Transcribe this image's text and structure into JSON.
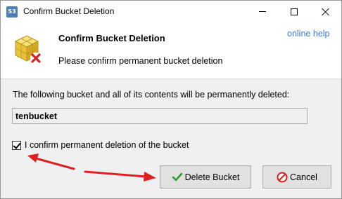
{
  "window": {
    "title": "Confirm Bucket Deletion",
    "app_icon_text": "S3"
  },
  "header": {
    "title": "Confirm Bucket Deletion",
    "subtitle": "Please confirm permanent bucket deletion",
    "help_link": "online help"
  },
  "body": {
    "info_text": "The following bucket and all of its contents will be permanently deleted:",
    "bucket_name": "tenbucket",
    "confirm_label": "I confirm permanent deletion of the bucket",
    "confirm_checked": true
  },
  "buttons": {
    "delete_label": "Delete Bucket",
    "cancel_label": "Cancel"
  },
  "icons": {
    "app": "s3-app-icon",
    "header": "bucket-delete-icon",
    "delete": "check-icon",
    "cancel": "cancel-icon"
  },
  "colors": {
    "link": "#3b7bd4",
    "annotation_arrow": "#e02020",
    "window_bg": "#f0f0f0"
  }
}
